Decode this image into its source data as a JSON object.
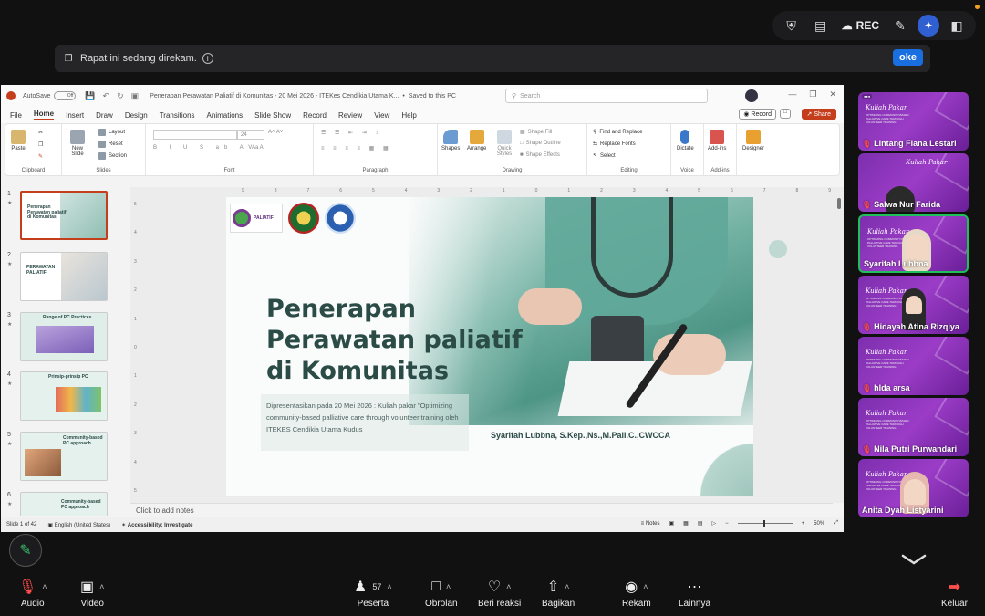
{
  "meeting": {
    "top": {
      "rec_label": "REC",
      "icons": [
        "shield-check-icon",
        "notes-icon",
        "cloud-rec-icon",
        "pencil-icon",
        "ai-sparkle-icon",
        "layout-icon"
      ]
    },
    "banner": {
      "text": "Rapat ini sedang direkam.",
      "button": "oke"
    },
    "controls": {
      "audio": "Audio",
      "video": "Video",
      "participants": "Peserta",
      "participant_count": "57",
      "chat": "Obrolan",
      "react": "Beri reaksi",
      "share": "Bagikan",
      "record": "Rekam",
      "more": "Lainnya",
      "leave": "Keluar"
    },
    "tiles": [
      {
        "name": "Lintang Fiana Lestari",
        "muted": true
      },
      {
        "name": "Salwa Nur Farida",
        "muted": true
      },
      {
        "name": "Syarifah Lubbna",
        "muted": false,
        "active": true
      },
      {
        "name": "Hidayah Atina Rizqiya",
        "muted": true
      },
      {
        "name": "hlda arsa",
        "muted": true
      },
      {
        "name": "Nila Putri Purwandari",
        "muted": true
      },
      {
        "name": "Anita Dyah Listyarini",
        "muted": false
      }
    ],
    "tile_text": {
      "title": "Kuliah Pakar",
      "sub": "OPTIMIZING COMMUNITY-BASED PALLIATIVE CARE THROUGH VOLUNTEER TRAINING"
    }
  },
  "ppt": {
    "autosave": "AutoSave",
    "toggle": "Off",
    "doc_title": "Penerapan Perawatan Paliatif di Komunitas - 20 Mei 2026 - ITEKes Cendikia Utama K...",
    "saved": "Saved to this PC",
    "search_placeholder": "Search",
    "menu": [
      "File",
      "Home",
      "Insert",
      "Draw",
      "Design",
      "Transitions",
      "Animations",
      "Slide Show",
      "Record",
      "Review",
      "View",
      "Help"
    ],
    "record_btn": "Record",
    "share_btn": "Share",
    "ribbon": {
      "paste": "Paste",
      "clipboard": "Clipboard",
      "new_slide": "New Slide",
      "layout": "Layout",
      "reset": "Reset",
      "section": "Section",
      "slides": "Slides",
      "font_size": "24",
      "font": "Font",
      "paragraph": "Paragraph",
      "shapes": "Shapes",
      "arrange": "Arrange",
      "quick_styles": "Quick Styles",
      "shape_fill": "Shape Fill",
      "shape_outline": "Shape Outline",
      "shape_effects": "Shape Effects",
      "drawing": "Drawing",
      "find_replace": "Find and Replace",
      "replace_fonts": "Replace Fonts",
      "select": "Select",
      "editing": "Editing",
      "dictate": "Dictate",
      "voice": "Voice",
      "addins": "Add-ins",
      "addins_grp": "Add-ins",
      "designer": "Designer"
    },
    "thumbs": [
      {
        "num": "1",
        "title": "Penerapan Perawatan paliatif di Komunitas"
      },
      {
        "num": "2",
        "title": "PERAWATAN PALIATIF"
      },
      {
        "num": "3",
        "title": "Range of PC Practices"
      },
      {
        "num": "4",
        "title": "Prinsip-prinsip PC"
      },
      {
        "num": "5",
        "title": "Community-based PC approach"
      },
      {
        "num": "6",
        "title": "Community-based PC approach"
      }
    ],
    "slide": {
      "logo_text": "PALIATIF",
      "title_lines": [
        "Penerapan",
        "Perawatan paliatif",
        "di Komunitas"
      ],
      "caption": "Dipresentasikan pada 20 Mei 2026 : Kuliah pakar \"Optimizing community-based palliative care through volunteer training oleh ITEKES Cendikia Utama Kudus",
      "presenter": "Syarifah Lubbna, S.Kep.,Ns.,M.Pall.C.,CWCCA"
    },
    "notes_placeholder": "Click to add notes",
    "status": {
      "slide_of": "Slide 1 of 42",
      "language": "English (United States)",
      "accessibility": "Accessibility: Investigate",
      "notes": "Notes",
      "zoom": "50%"
    }
  }
}
